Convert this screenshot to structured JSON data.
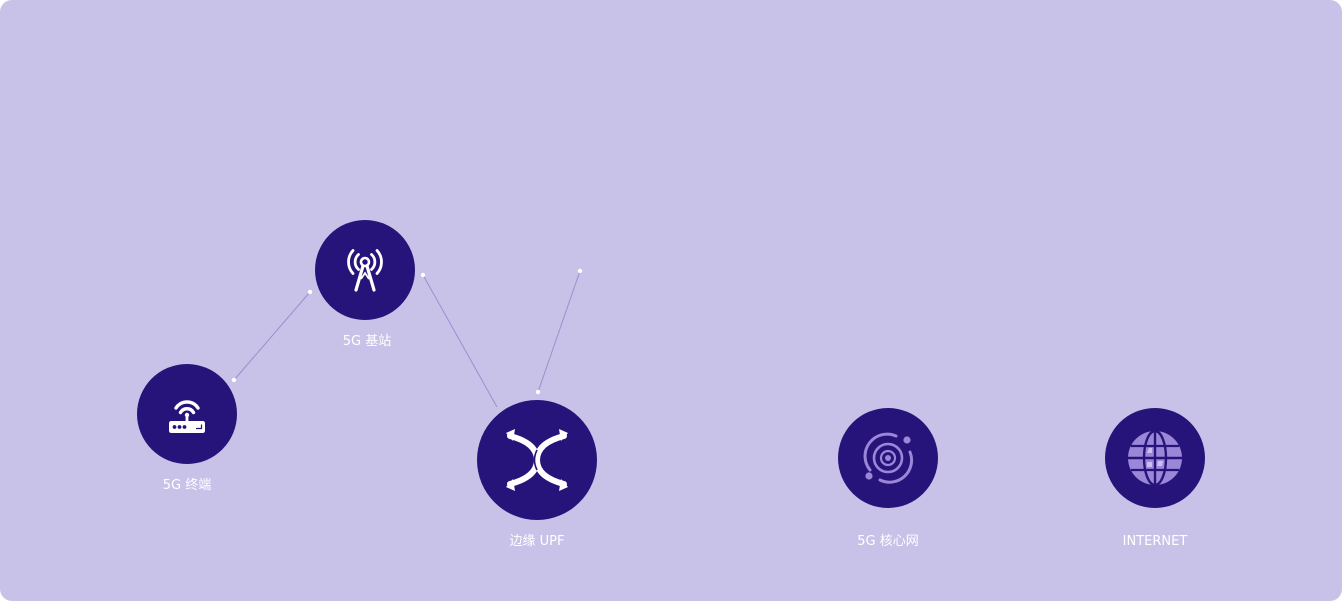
{
  "colors": {
    "background": "#c9c2e8",
    "node_fill": "#27147a",
    "icon_white": "#ffffff",
    "icon_lilac": "#9b87d8",
    "connector": "#9a8fcf"
  },
  "nodes": {
    "terminal": {
      "label": "5G 终端",
      "icon": "router-icon"
    },
    "base_station": {
      "label": "5G 基站",
      "icon": "antenna-tower-icon"
    },
    "edge_upf": {
      "label": "边缘 UPF",
      "icon": "switch-arrows-icon"
    },
    "core_network": {
      "label": "5G 核心网",
      "icon": "orbit-icon"
    },
    "internet": {
      "label": "INTERNET",
      "icon": "globe-icon"
    }
  }
}
